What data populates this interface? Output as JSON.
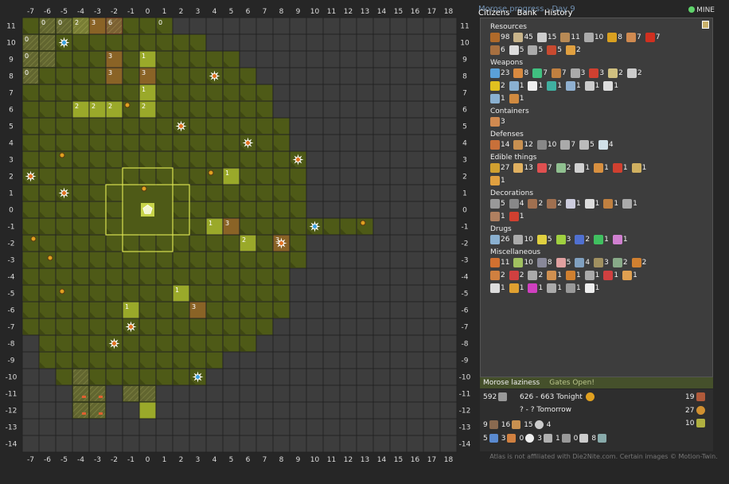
{
  "map": {
    "x_axis": [
      "-7",
      "-6",
      "-5",
      "-4",
      "-3",
      "-2",
      "-1",
      "0",
      "1",
      "2",
      "3",
      "4",
      "5",
      "6",
      "7",
      "8",
      "9",
      "10",
      "11",
      "12",
      "13",
      "14",
      "15",
      "16",
      "17",
      "18"
    ],
    "y_axis": [
      "11",
      "10",
      "9",
      "8",
      "7",
      "6",
      "5",
      "4",
      "3",
      "2",
      "1",
      "0",
      "-1",
      "-2",
      "-3",
      "-4",
      "-5",
      "-6",
      "-7",
      "-8",
      "-9",
      "-10",
      "-11",
      "-12",
      "-13",
      "-14"
    ],
    "town_icon": "town-pentagon",
    "cell_numbers": [
      {
        "x": -6,
        "y": 11,
        "t": "0"
      },
      {
        "x": -5,
        "y": 11,
        "t": "0"
      },
      {
        "x": -4,
        "y": 11,
        "t": "2"
      },
      {
        "x": -3,
        "y": 11,
        "t": "3"
      },
      {
        "x": -2,
        "y": 11,
        "t": "6"
      },
      {
        "x": 1,
        "y": 11,
        "t": "0"
      },
      {
        "x": -7,
        "y": 10,
        "t": "0"
      },
      {
        "x": -7,
        "y": 9,
        "t": "0"
      },
      {
        "x": -7,
        "y": 8,
        "t": "0"
      },
      {
        "x": -2,
        "y": 9,
        "t": "3"
      },
      {
        "x": 0,
        "y": 9,
        "t": "1"
      },
      {
        "x": -2,
        "y": 8,
        "t": "3"
      },
      {
        "x": 0,
        "y": 8,
        "t": "3"
      },
      {
        "x": 0,
        "y": 7,
        "t": "1"
      },
      {
        "x": -4,
        "y": 6,
        "t": "2"
      },
      {
        "x": -3,
        "y": 6,
        "t": "2"
      },
      {
        "x": -2,
        "y": 6,
        "t": "2"
      },
      {
        "x": 0,
        "y": 6,
        "t": "2"
      },
      {
        "x": 5,
        "y": 2,
        "t": "1"
      },
      {
        "x": 4,
        "y": -1,
        "t": "1"
      },
      {
        "x": 5,
        "y": -1,
        "t": "3"
      },
      {
        "x": 6,
        "y": -2,
        "t": "2"
      },
      {
        "x": 8,
        "y": -2,
        "t": "3"
      },
      {
        "x": 2,
        "y": -5,
        "t": "1"
      },
      {
        "x": -1,
        "y": -6,
        "t": "1"
      },
      {
        "x": 3,
        "y": -6,
        "t": "3"
      }
    ]
  },
  "sidebar": {
    "title": "Morose progress - Day 9",
    "mine_label": "MINE",
    "tabs": [
      "Citizens",
      "Bank",
      "History"
    ],
    "categories": [
      {
        "name": "Resources",
        "rows": [
          [
            {
              "icon": "wood-icon",
              "v": "98",
              "c": "#b06a2a"
            },
            {
              "icon": "scrap-icon",
              "v": "45",
              "c": "#c8b48a"
            },
            {
              "icon": "tools-icon",
              "v": "15",
              "c": "#ccc"
            },
            {
              "icon": "rock-icon",
              "v": "11",
              "c": "#b88a55"
            },
            {
              "icon": "beam-icon",
              "v": "10",
              "c": "#aaa"
            },
            {
              "icon": "battery-icon",
              "v": "8",
              "c": "#d9a020"
            },
            {
              "icon": "plank-icon",
              "v": "7",
              "c": "#d08a50"
            },
            {
              "icon": "tube-icon",
              "v": "7",
              "c": "#d03020"
            }
          ],
          [
            {
              "icon": "board-icon",
              "v": "6",
              "c": "#a87040"
            },
            {
              "icon": "tape-icon",
              "v": "5",
              "c": "#ddd"
            },
            {
              "icon": "parts-icon",
              "v": "5",
              "c": "#aaa"
            },
            {
              "icon": "rope-icon",
              "v": "5",
              "c": "#c84a30"
            },
            {
              "icon": "plank-icon",
              "v": "2",
              "c": "#e0a040"
            }
          ]
        ]
      },
      {
        "name": "Weapons",
        "rows": [
          [
            {
              "icon": "knife-icon",
              "v": "23",
              "c": "#5aa0d8"
            },
            {
              "icon": "guns-icon",
              "v": "8",
              "c": "#d88a40"
            },
            {
              "icon": "pistol-icon",
              "v": "7",
              "c": "#40c080"
            },
            {
              "icon": "saw-icon",
              "v": "7",
              "c": "#c08040"
            },
            {
              "icon": "chain-icon",
              "v": "3",
              "c": "#aaa"
            },
            {
              "icon": "blade-icon",
              "v": "3",
              "c": "#d04030"
            },
            {
              "icon": "wrench-icon",
              "v": "2",
              "c": "#d0c080"
            },
            {
              "icon": "lens-icon",
              "v": "2",
              "c": "#ccc"
            }
          ],
          [
            {
              "icon": "battery-icon",
              "v": "2",
              "c": "#e0c020"
            },
            {
              "icon": "bottle-icon",
              "v": "1",
              "c": "#8ab0d0"
            },
            {
              "icon": "bone-icon",
              "v": "1",
              "c": "#eee"
            },
            {
              "icon": "grenade-icon",
              "v": "1",
              "c": "#40b0a0"
            },
            {
              "icon": "probe-icon",
              "v": "1",
              "c": "#90b0d0"
            },
            {
              "icon": "pin-icon",
              "v": "1",
              "c": "#ccc"
            },
            {
              "icon": "pin-icon",
              "v": "1",
              "c": "#ddd"
            }
          ],
          [
            {
              "icon": "flask-icon",
              "v": "1",
              "c": "#8ab0d0"
            },
            {
              "icon": "hammer-icon",
              "v": "1",
              "c": "#d08a40"
            }
          ]
        ]
      },
      {
        "name": "Containers",
        "rows": [
          [
            {
              "icon": "box-icon",
              "v": "3",
              "c": "#d08a50"
            }
          ]
        ]
      },
      {
        "name": "Defenses",
        "rows": [
          [
            {
              "icon": "door-icon",
              "v": "14",
              "c": "#c8703a"
            },
            {
              "icon": "fence-icon",
              "v": "12",
              "c": "#c89050"
            },
            {
              "icon": "plate-icon",
              "v": "10",
              "c": "#888"
            },
            {
              "icon": "spikes-icon",
              "v": "7",
              "c": "#aaa"
            },
            {
              "icon": "rubble-icon",
              "v": "5",
              "c": "#bbb"
            },
            {
              "icon": "sheet-icon",
              "v": "4",
              "c": "#d0e0e8"
            }
          ]
        ]
      },
      {
        "name": "Edible things",
        "rows": [
          [
            {
              "icon": "food-icon",
              "v": "27",
              "c": "#d0a030"
            },
            {
              "icon": "meat-icon",
              "v": "13",
              "c": "#e0b060"
            },
            {
              "icon": "steak-icon",
              "v": "7",
              "c": "#e05050"
            },
            {
              "icon": "can-icon",
              "v": "2",
              "c": "#90c090"
            },
            {
              "icon": "pills-icon",
              "v": "1",
              "c": "#d0d0d0"
            },
            {
              "icon": "burger-icon",
              "v": "1",
              "c": "#d89040"
            },
            {
              "icon": "candy-icon",
              "v": "1",
              "c": "#d04030"
            },
            {
              "icon": "cracker-icon",
              "v": "1",
              "c": "#d0b060"
            }
          ],
          [
            {
              "icon": "drink-icon",
              "v": "1",
              "c": "#e0a040"
            }
          ]
        ]
      },
      {
        "name": "Decorations",
        "rows": [
          [
            {
              "icon": "carpet-icon",
              "v": "5",
              "c": "#999"
            },
            {
              "icon": "radio-icon",
              "v": "4",
              "c": "#888"
            },
            {
              "icon": "chair-icon",
              "v": "2",
              "c": "#a07050"
            },
            {
              "icon": "chair-icon",
              "v": "2",
              "c": "#a07050"
            },
            {
              "icon": "frame-icon",
              "v": "1",
              "c": "#ccd"
            },
            {
              "icon": "poster-icon",
              "v": "1",
              "c": "#ddd"
            },
            {
              "icon": "teddy-icon",
              "v": "1",
              "c": "#c08040"
            },
            {
              "icon": "tv-icon",
              "v": "1",
              "c": "#aaa"
            }
          ],
          [
            {
              "icon": "plant-icon",
              "v": "1",
              "c": "#b08060"
            },
            {
              "icon": "lamp-icon",
              "v": "1",
              "c": "#d04030"
            }
          ]
        ]
      },
      {
        "name": "Drugs",
        "rows": [
          [
            {
              "icon": "syringe-icon",
              "v": "26",
              "c": "#8ab0d0"
            },
            {
              "icon": "jar-icon",
              "v": "10",
              "c": "#aaa"
            },
            {
              "icon": "dropper-icon",
              "v": "5",
              "c": "#e0d040"
            },
            {
              "icon": "capsule-icon",
              "v": "3",
              "c": "#a0d040"
            },
            {
              "icon": "kit-icon",
              "v": "2",
              "c": "#5070d0"
            },
            {
              "icon": "pill-icon",
              "v": "1",
              "c": "#40c060"
            },
            {
              "icon": "drug-box-icon",
              "v": "1",
              "c": "#d080d0"
            }
          ]
        ]
      },
      {
        "name": "Miscellaneous",
        "rows": [
          [
            {
              "icon": "book-icon",
              "v": "11",
              "c": "#d07030"
            },
            {
              "icon": "cabinet-icon",
              "v": "10",
              "c": "#a0c060"
            },
            {
              "icon": "lamp-icon",
              "v": "8",
              "c": "#889"
            },
            {
              "icon": "brain-icon",
              "v": "5",
              "c": "#e0a0a0"
            },
            {
              "icon": "spray-icon",
              "v": "4",
              "c": "#80a0c0"
            },
            {
              "icon": "bag-icon",
              "v": "3",
              "c": "#a09060"
            },
            {
              "icon": "lock-icon",
              "v": "2",
              "c": "#8a8"
            },
            {
              "icon": "case-icon",
              "v": "2",
              "c": "#d08030"
            }
          ],
          [
            {
              "icon": "ticket-icon",
              "v": "2",
              "c": "#d08040"
            },
            {
              "icon": "gun-icon",
              "v": "2",
              "c": "#d04040"
            },
            {
              "icon": "note-icon",
              "v": "2",
              "c": "#aaa"
            },
            {
              "icon": "bottle-icon",
              "v": "1",
              "c": "#d09050"
            },
            {
              "icon": "can-icon",
              "v": "1",
              "c": "#d08030"
            },
            {
              "icon": "battery-icon",
              "v": "1",
              "c": "#aaa"
            },
            {
              "icon": "cart-icon",
              "v": "1",
              "c": "#d04040"
            },
            {
              "icon": "bowl-icon",
              "v": "1",
              "c": "#e0a050"
            }
          ],
          [
            {
              "icon": "screw-icon",
              "v": "1",
              "c": "#ddd"
            },
            {
              "icon": "flask-icon",
              "v": "1",
              "c": "#e0a030"
            },
            {
              "icon": "toy-icon",
              "v": "1",
              "c": "#d040c0"
            },
            {
              "icon": "chest-icon",
              "v": "1",
              "c": "#aaa"
            },
            {
              "icon": "cart-icon",
              "v": "1",
              "c": "#999"
            },
            {
              "icon": "cubes-icon",
              "v": "1",
              "c": "#eee"
            }
          ]
        ]
      }
    ],
    "status_label": "Morose laziness",
    "gates_label": "Gates Open!",
    "stats": {
      "defense": "592",
      "attack_tonight": "626 - 663 Tonight",
      "attack_tomorrow": "? - ? Tomorrow",
      "right_top": "19",
      "right_mid": "27",
      "right_bot": "10",
      "row3": [
        "9",
        "16",
        "15",
        "4"
      ],
      "row4": [
        "5",
        "3",
        "0",
        "3",
        "1",
        "0",
        "8"
      ]
    },
    "footer": "Atlas is not affiliated with Die2Nite.com. Certain images © Motion-Twin."
  },
  "colors": {
    "explored": "#4e5a17",
    "explored_light": "#5a6620",
    "unexplored": "#3d3d3d",
    "grid": "#222",
    "highlight": "#9aa92a",
    "orange": "#8a6326",
    "red": "#a04a22"
  }
}
